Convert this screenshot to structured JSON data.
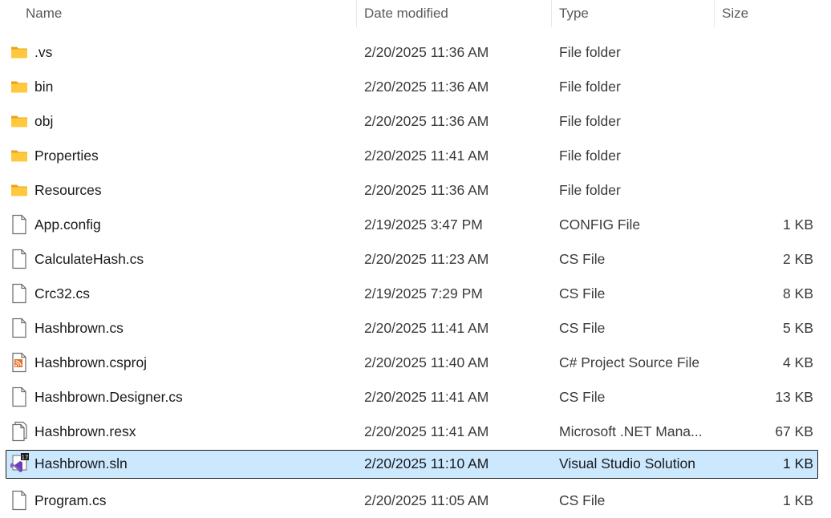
{
  "columns": {
    "name": "Name",
    "date": "Date modified",
    "type": "Type",
    "size": "Size"
  },
  "files": [
    {
      "name": ".vs",
      "date": "2/20/2025 11:36 AM",
      "type": "File folder",
      "size": "",
      "icon": "folder-icon"
    },
    {
      "name": "bin",
      "date": "2/20/2025 11:36 AM",
      "type": "File folder",
      "size": "",
      "icon": "folder-icon"
    },
    {
      "name": "obj",
      "date": "2/20/2025 11:36 AM",
      "type": "File folder",
      "size": "",
      "icon": "folder-icon"
    },
    {
      "name": "Properties",
      "date": "2/20/2025 11:41 AM",
      "type": "File folder",
      "size": "",
      "icon": "folder-icon"
    },
    {
      "name": "Resources",
      "date": "2/20/2025 11:36 AM",
      "type": "File folder",
      "size": "",
      "icon": "folder-icon"
    },
    {
      "name": "App.config",
      "date": "2/19/2025 3:47 PM",
      "type": "CONFIG File",
      "size": "1 KB",
      "icon": "file-icon"
    },
    {
      "name": "CalculateHash.cs",
      "date": "2/20/2025 11:23 AM",
      "type": "CS File",
      "size": "2 KB",
      "icon": "file-icon"
    },
    {
      "name": "Crc32.cs",
      "date": "2/19/2025 7:29 PM",
      "type": "CS File",
      "size": "8 KB",
      "icon": "file-icon"
    },
    {
      "name": "Hashbrown.cs",
      "date": "2/20/2025 11:41 AM",
      "type": "CS File",
      "size": "5 KB",
      "icon": "file-icon"
    },
    {
      "name": "Hashbrown.csproj",
      "date": "2/20/2025 11:40 AM",
      "type": "C# Project Source File",
      "size": "4 KB",
      "icon": "rss-file-icon"
    },
    {
      "name": "Hashbrown.Designer.cs",
      "date": "2/20/2025 11:41 AM",
      "type": "CS File",
      "size": "13 KB",
      "icon": "file-icon"
    },
    {
      "name": "Hashbrown.resx",
      "date": "2/20/2025 11:41 AM",
      "type": "Microsoft .NET Mana...",
      "size": "67 KB",
      "icon": "resx-file-icon"
    },
    {
      "name": "Hashbrown.sln",
      "date": "2/20/2025 11:10 AM",
      "type": "Visual Studio Solution",
      "size": "1 KB",
      "icon": "visual-studio-solution-icon",
      "selected": true
    },
    {
      "name": "Program.cs",
      "date": "2/20/2025 11:05 AM",
      "type": "CS File",
      "size": "1 KB",
      "icon": "file-icon"
    }
  ],
  "colors": {
    "selection_background": "#cce8ff",
    "folder_yellow": "#ffc83d",
    "header_text": "#5a5a5a"
  }
}
